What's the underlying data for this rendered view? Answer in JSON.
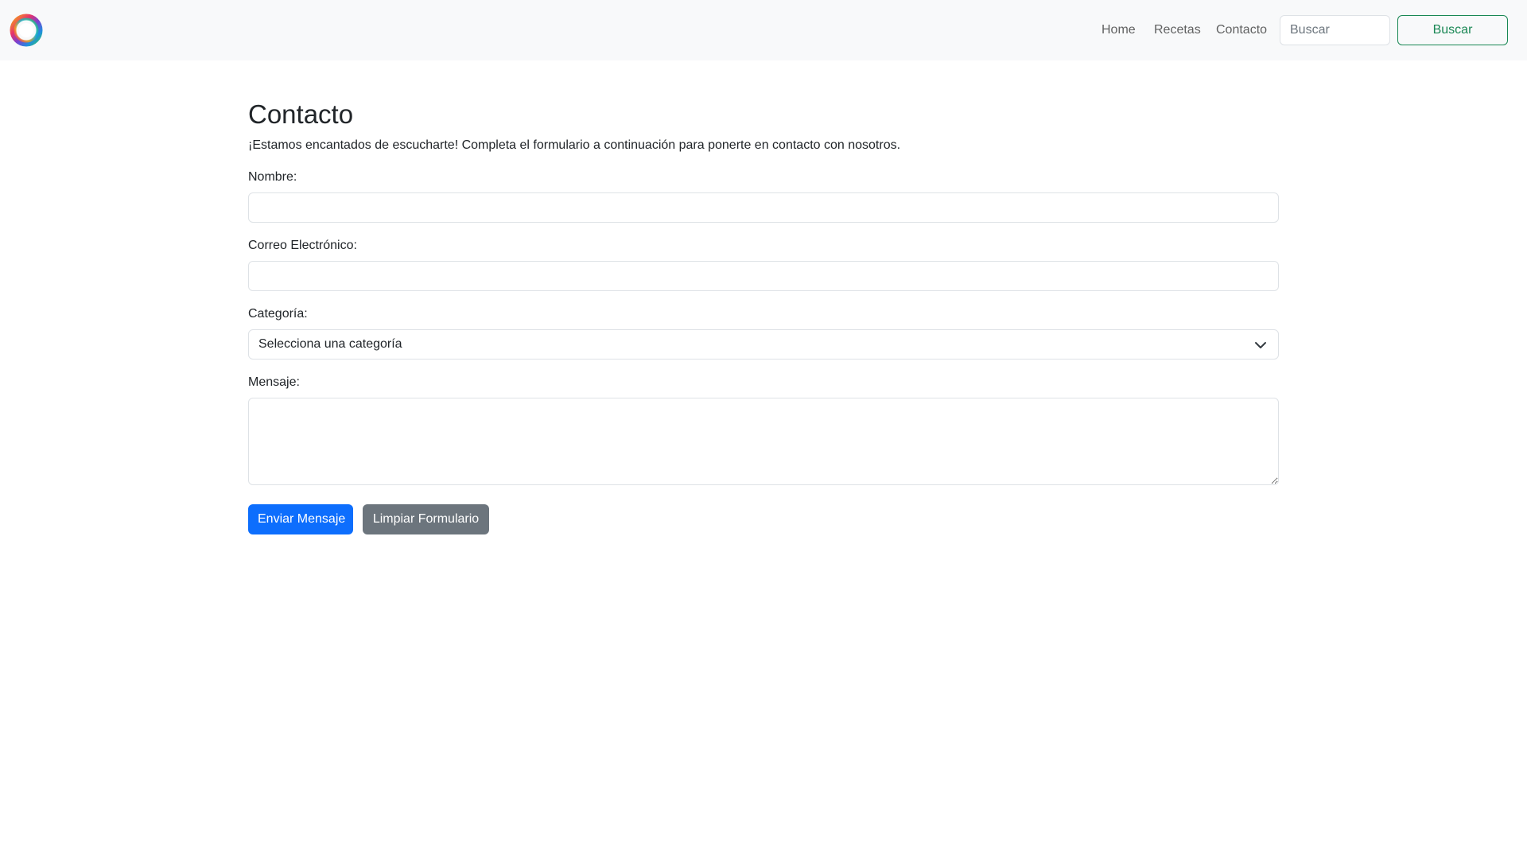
{
  "navbar": {
    "logo_icon": "ring-logo-icon",
    "links": [
      {
        "label": "Home"
      },
      {
        "label": "Recetas"
      },
      {
        "label": "Contacto"
      }
    ],
    "search": {
      "placeholder": "Buscar",
      "button_label": "Buscar"
    }
  },
  "main": {
    "title": "Contacto",
    "intro": "¡Estamos encantados de escucharte! Completa el formulario a continuación para ponerte en contacto con nosotros.",
    "form": {
      "name_label": "Nombre:",
      "name_value": "",
      "email_label": "Correo Electrónico:",
      "email_value": "",
      "category_label": "Categoría:",
      "category_selected": "Selecciona una categoría",
      "message_label": "Mensaje:",
      "message_value": "",
      "submit_label": "Enviar Mensaje",
      "reset_label": "Limpiar Formulario"
    }
  },
  "colors": {
    "primary": "#0d6efd",
    "secondary": "#6c757d",
    "success_outline": "#198754",
    "navbar_bg": "#f8f9fa"
  }
}
